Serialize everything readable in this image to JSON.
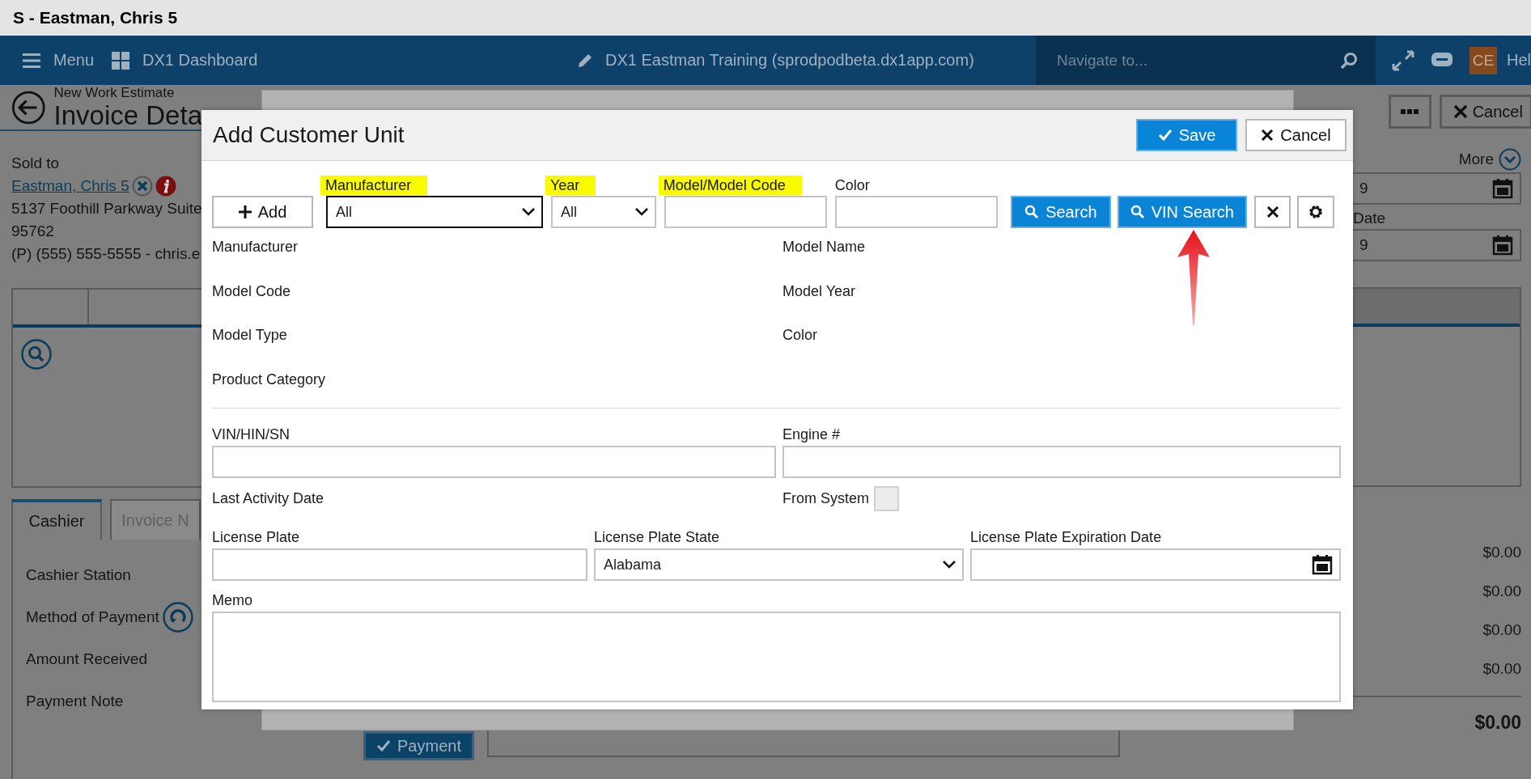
{
  "window": {
    "title": "S - Eastman, Chris 5"
  },
  "nav": {
    "menu": "Menu",
    "dashboard": "DX1 Dashboard",
    "environment": "DX1 Eastman Training (sprodpodbeta.dx1app.com)",
    "search_placeholder": "Navigate to...",
    "avatar": "CE",
    "help": "Hel"
  },
  "page": {
    "subtitle": "New Work Estimate",
    "title": "Invoice Deta",
    "sold_to_label": "Sold to",
    "customer": "Eastman, Chris 5",
    "address": "5137 Foothill Parkway Suite",
    "zip": "95762",
    "contact": "(P) (555) 555-5555 - chris.e",
    "tabs": [
      {
        "label": "Cashier",
        "selected": true
      },
      {
        "label": "Invoice N",
        "selected": false
      }
    ],
    "payment_fields": [
      "Cashier Station",
      "Method of Payment",
      "Amount Received",
      "Payment Note"
    ],
    "payment_button": "Payment",
    "cancel": "Cancel",
    "more": "More",
    "date_value": "9",
    "date_label": "Date",
    "date_value_2": "9",
    "amounts": [
      "$0.00",
      "$0.00",
      "$0.00",
      "$0.00"
    ],
    "total": "$0.00"
  },
  "dialog": {
    "title": "Add Customer Unit",
    "save": "Save",
    "cancel": "Cancel",
    "add": "Add",
    "filters": [
      {
        "label": "Manufacturer",
        "highlighted": true,
        "kind": "select",
        "value": "All",
        "focused": true
      },
      {
        "label": "Year",
        "highlighted": true,
        "kind": "select",
        "value": "All",
        "focused": false
      },
      {
        "label": "Model/Model Code",
        "highlighted": true,
        "kind": "input",
        "focused": false
      },
      {
        "label": "Color",
        "highlighted": false,
        "kind": "input",
        "focused": false
      }
    ],
    "search": "Search",
    "vin_search": "VIN Search",
    "details": [
      "Manufacturer",
      "Model Name",
      "Model Code",
      "Model Year",
      "Model Type",
      "Color",
      "Product Category"
    ],
    "vin": "VIN/HIN/SN",
    "engine": "Engine #",
    "last_activity": "Last Activity Date",
    "from_system": {
      "label": "From System",
      "checked": false
    },
    "license_plate": "License Plate",
    "license_state": {
      "label": "License Plate State",
      "value": "Alabama"
    },
    "license_expiration": "License Plate Expiration Date",
    "memo": "Memo"
  }
}
